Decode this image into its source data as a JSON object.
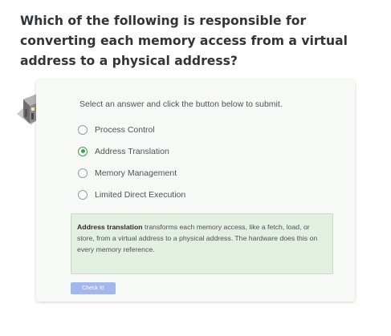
{
  "question": {
    "text": "Which of the following is responsible for converting each memory access from a virtual address to a physical address?"
  },
  "quiz": {
    "mascot_icon": "robot-mascot-icon",
    "instruction": "Select an answer and click the button below to submit.",
    "options": [
      {
        "label": "Process Control",
        "selected": false
      },
      {
        "label": "Address Translation",
        "selected": true
      },
      {
        "label": "Memory Management",
        "selected": false
      },
      {
        "label": "Limited Direct Execution",
        "selected": false
      }
    ],
    "feedback": {
      "term": "Address translation",
      "text": " transforms each memory access, like a fetch, load, or store, from a virtual address to a physical address. The hardware does this on every memory reference."
    },
    "check_label": "Check It!"
  },
  "colors": {
    "accent_green": "#3da34a",
    "feedback_bg": "#e3efe1",
    "button_disabled": "#a3b6ee",
    "card_bg": "#f6f9f5"
  }
}
